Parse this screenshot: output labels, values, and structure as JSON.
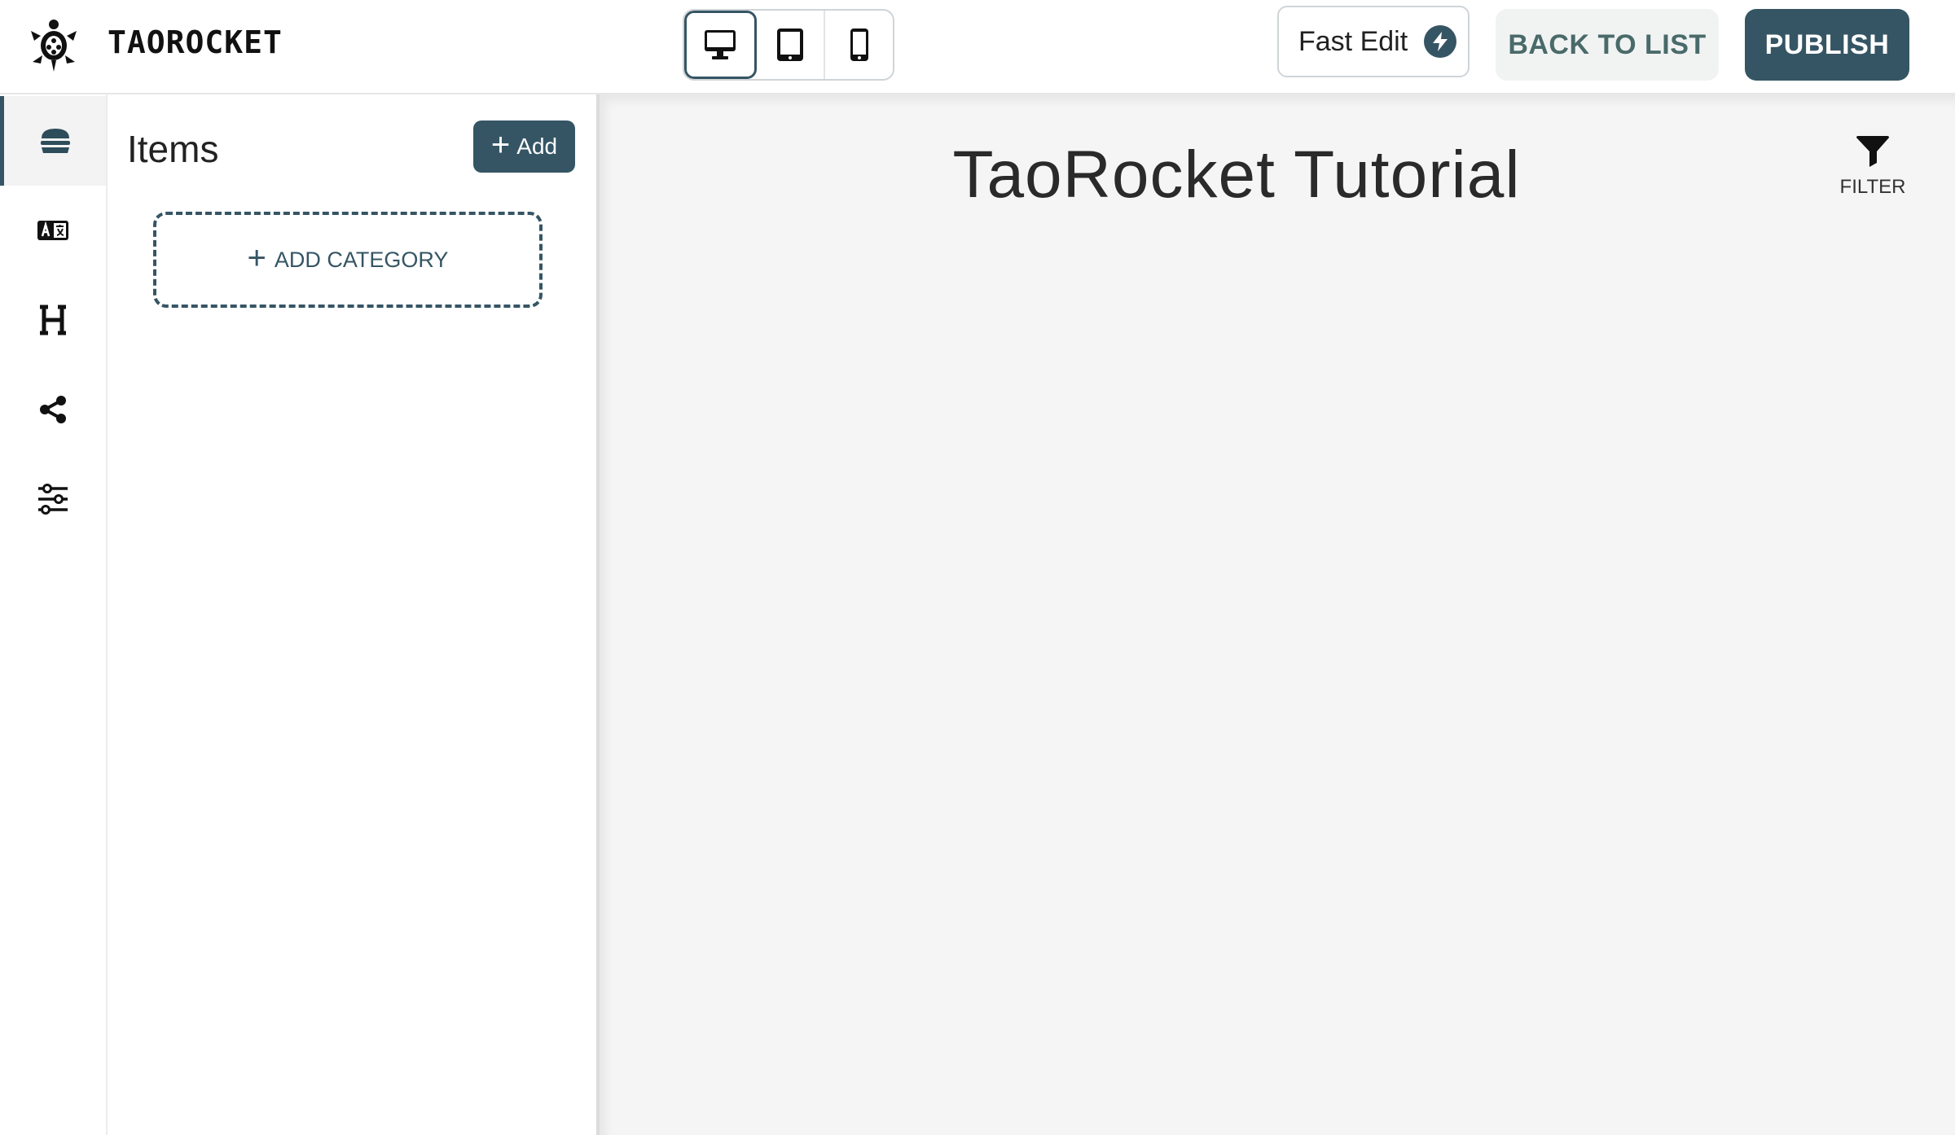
{
  "header": {
    "brand": "TAOROCKET",
    "fast_edit_label": "Fast Edit",
    "back_label": "BACK TO LIST",
    "publish_label": "PUBLISH",
    "devices": [
      "desktop-icon",
      "tablet-icon",
      "mobile-icon"
    ],
    "active_device": "desktop"
  },
  "rail": {
    "items": [
      "burger-icon",
      "translate-icon",
      "heading-icon",
      "share-icon",
      "sliders-icon"
    ],
    "active": "burger-icon"
  },
  "panel": {
    "title": "Items",
    "add_label": "Add",
    "add_category_label": "ADD CATEGORY"
  },
  "preview": {
    "title": "TaoRocket Tutorial",
    "filter_label": "FILTER"
  },
  "colors": {
    "accent": "#355564",
    "preview_bg": "#f5f5f5"
  }
}
